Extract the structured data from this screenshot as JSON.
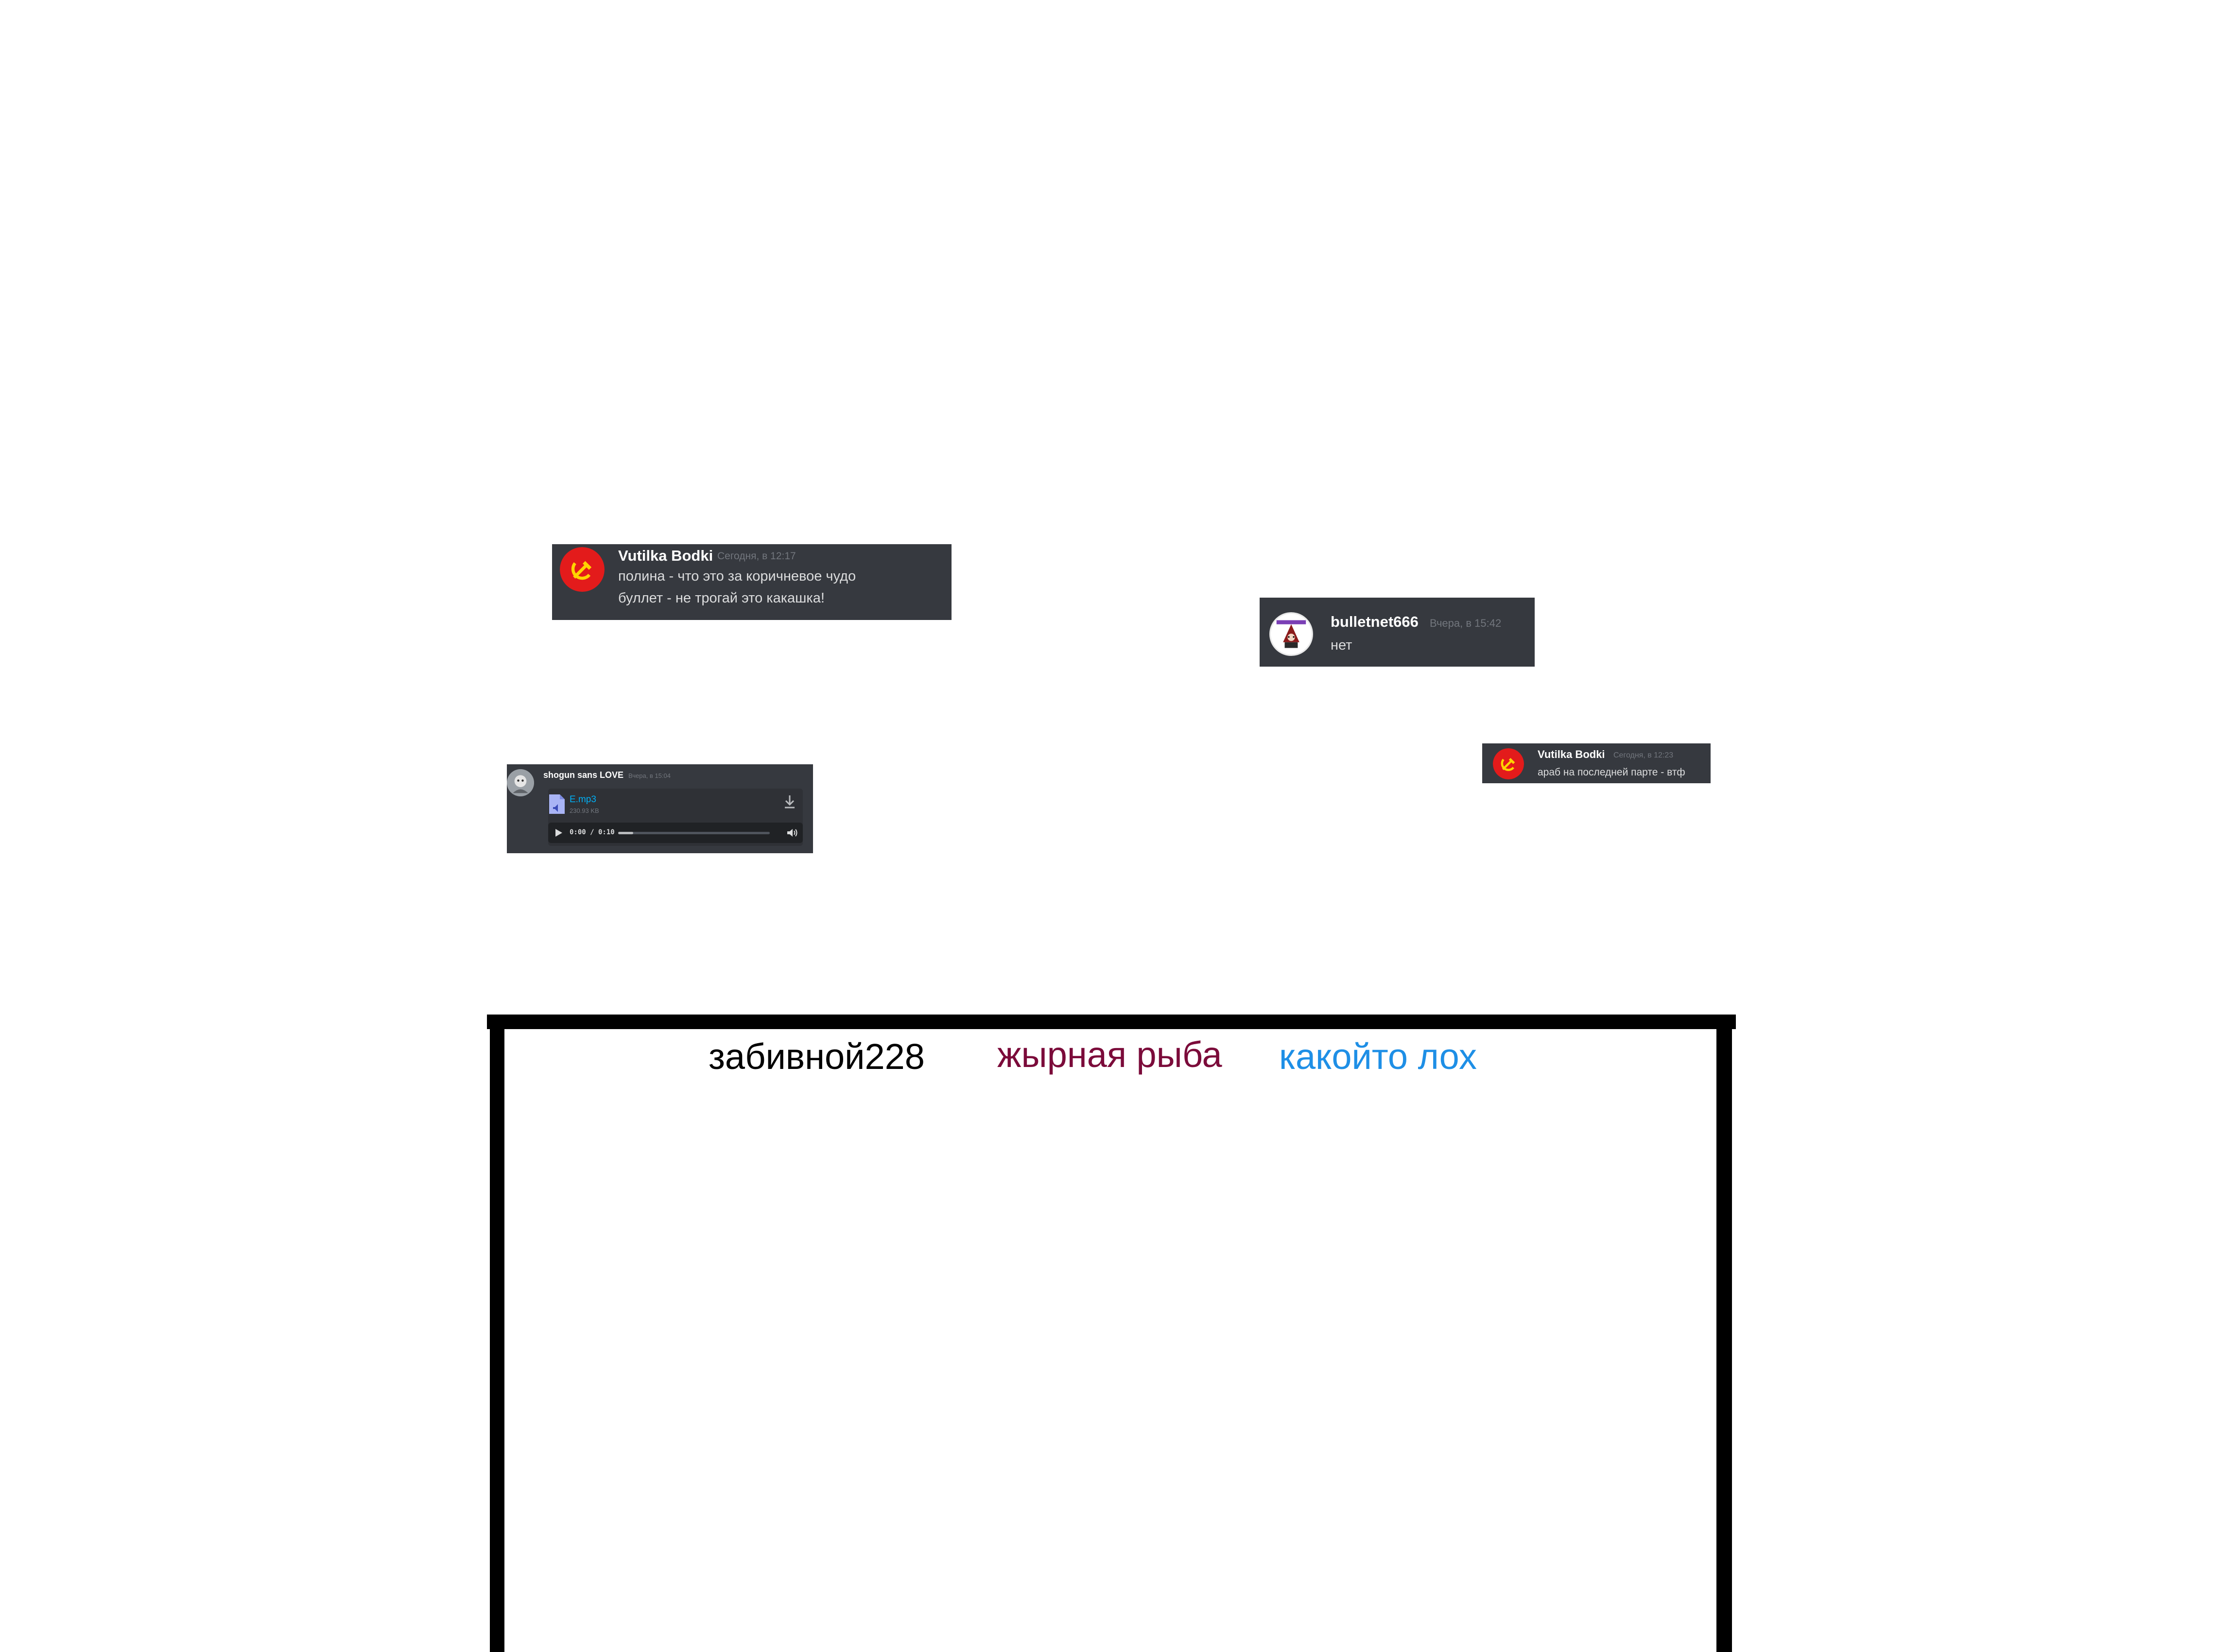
{
  "messages": [
    {
      "username": "Vutilka Bodki",
      "timestamp": "Сегодня, в 12:17",
      "lines": [
        "полина - что это за коричневое чудо",
        "буллет - не трогай это какашка!"
      ],
      "avatar_icon": "hammer-sickle-icon"
    },
    {
      "username": "bulletnet666",
      "timestamp": "Вчера, в 15:42",
      "lines": [
        "нет"
      ],
      "avatar_icon": "character-avatar-icon"
    },
    {
      "username": "Vutilka Bodki",
      "timestamp": "Сегодня, в 12:23",
      "lines": [
        "араб на последней парте - втф"
      ],
      "avatar_icon": "hammer-sickle-icon"
    },
    {
      "username": "shogun sans LOVE",
      "timestamp": "Вчера, в 15:04",
      "attachment": {
        "filename": "E.mp3",
        "filesize": "230.93 KB",
        "time": "0:00 / 0:10",
        "progress": 0.1
      },
      "avatar_icon": "character-avatar-icon"
    }
  ],
  "board": {
    "columns": [
      {
        "label": "забивной228",
        "color": "#000000"
      },
      {
        "label": "жырная рыба",
        "color": "#7b0b3a"
      },
      {
        "label": "какойто лох",
        "color": "#1e8fe6"
      }
    ]
  },
  "colors": {
    "discord_bg": "#36393f",
    "attachment_bg": "#2f3136",
    "link": "#00aff4",
    "avatar_red": "#e31b1b",
    "emblem_yellow": "#ffd400"
  }
}
